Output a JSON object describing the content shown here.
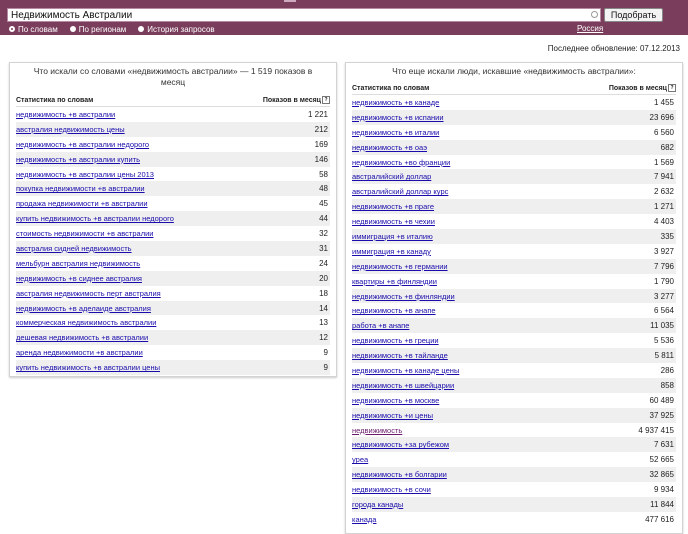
{
  "search": {
    "query": "Недвижимость Австралии",
    "button_label": "Подобрать",
    "modes": [
      {
        "label": "По словам",
        "selected": true
      },
      {
        "label": "По регионам",
        "selected": false
      },
      {
        "label": "История запросов",
        "selected": false
      }
    ],
    "region": "Россия"
  },
  "updated": "Последнее обновление: 07.12.2013",
  "left_panel": {
    "title": "Что искали со словами «недвижимость австралии» — 1 519 показов в месяц",
    "col_query": "Статистика по словам",
    "col_count": "Показов в месяц",
    "rows": [
      {
        "q": "недвижимость +в австралии",
        "n": "1 221"
      },
      {
        "q": "австралия недвижимость цены",
        "n": "212"
      },
      {
        "q": "недвижимость +в австралии недорого",
        "n": "169"
      },
      {
        "q": "недвижимость +в австралии купить",
        "n": "146"
      },
      {
        "q": "недвижимость +в австралии цены 2013",
        "n": "58"
      },
      {
        "q": "покупка недвижимости +в австралии",
        "n": "48"
      },
      {
        "q": "продажа недвижимости +в австралии",
        "n": "45"
      },
      {
        "q": "купить недвижимость +в австралии недорого",
        "n": "44"
      },
      {
        "q": "стоимость недвижимости +в австралии",
        "n": "32"
      },
      {
        "q": "австралия сидней недвижимость",
        "n": "31"
      },
      {
        "q": "мельбурн австралия недвижимость",
        "n": "24"
      },
      {
        "q": "недвижимость +в сиднее австралия",
        "n": "20"
      },
      {
        "q": "австралия недвижимость перт австралия",
        "n": "18"
      },
      {
        "q": "недвижимость +в аделаиде австралия",
        "n": "14"
      },
      {
        "q": "коммерческая недвижимость австралии",
        "n": "13"
      },
      {
        "q": "дешевая недвижимость +в австралии",
        "n": "12"
      },
      {
        "q": "аренда недвижимости +в австралии",
        "n": "9"
      },
      {
        "q": "купить недвижимость +в австралии цены",
        "n": "9"
      }
    ]
  },
  "right_panel": {
    "title": "Что еще искали люди, искавшие «недвижимость австралии»:",
    "col_query": "Статистика по словам",
    "col_count": "Показов в месяц",
    "rows": [
      {
        "q": "недвижимость +в канаде",
        "n": "1 455"
      },
      {
        "q": "недвижимость +в испании",
        "n": "23 696"
      },
      {
        "q": "недвижимость +в италии",
        "n": "6 560"
      },
      {
        "q": "недвижимость +в оаэ",
        "n": "682"
      },
      {
        "q": "недвижимость +во франции",
        "n": "1 569"
      },
      {
        "q": "австралийский доллар",
        "n": "7 941"
      },
      {
        "q": "австралийский доллар курс",
        "n": "2 632"
      },
      {
        "q": "недвижимость +в праге",
        "n": "1 271"
      },
      {
        "q": "недвижимость +в чехии",
        "n": "4 403"
      },
      {
        "q": "иммиграция +в италию",
        "n": "335"
      },
      {
        "q": "иммиграция +в канаду",
        "n": "3 927"
      },
      {
        "q": "недвижимость +в германии",
        "n": "7 796"
      },
      {
        "q": "квартиры +в финляндии",
        "n": "1 790"
      },
      {
        "q": "недвижимость +в финляндии",
        "n": "3 277"
      },
      {
        "q": "недвижимость +в анапе",
        "n": "6 564"
      },
      {
        "q": "работа +в анапе",
        "n": "11 035"
      },
      {
        "q": "недвижимость +в греции",
        "n": "5 536"
      },
      {
        "q": "недвижимость +в тайланде",
        "n": "5 811"
      },
      {
        "q": "недвижимость +в канаде цены",
        "n": "286"
      },
      {
        "q": "недвижимость +в швейцарии",
        "n": "858"
      },
      {
        "q": "недвижимость +в москве",
        "n": "60 489"
      },
      {
        "q": "недвижимость +и цены",
        "n": "37 925"
      },
      {
        "q": "недвижимость",
        "n": "4 937 415",
        "visited": true
      },
      {
        "q": "недвижимость +за рубежом",
        "n": "7 631"
      },
      {
        "q": "уреа",
        "n": "52 665"
      },
      {
        "q": "недвижимость +в болгарии",
        "n": "32 865"
      },
      {
        "q": "недвижимость +в сочи",
        "n": "9 934"
      },
      {
        "q": "города канады",
        "n": "11 844"
      },
      {
        "q": "канада",
        "n": "477 616"
      }
    ]
  }
}
